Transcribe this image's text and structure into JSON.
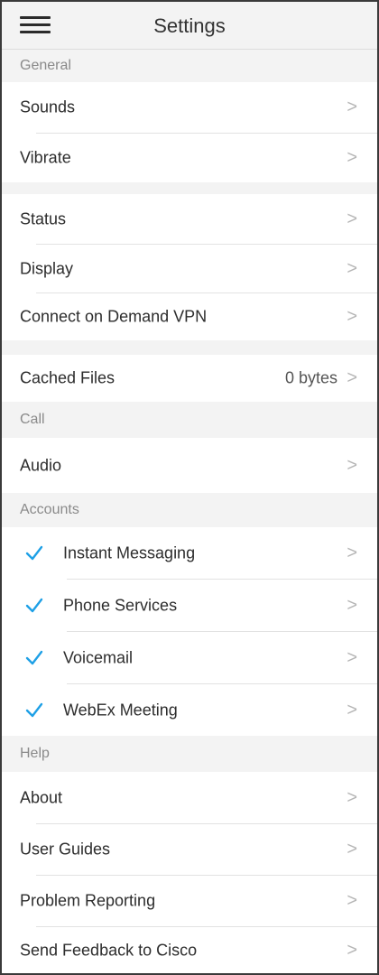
{
  "header": {
    "title": "Settings"
  },
  "colors": {
    "accent": "#1ea0e6"
  },
  "sections": {
    "general": "General",
    "call": "Call",
    "accounts": "Accounts",
    "help": "Help"
  },
  "items": {
    "sounds": "Sounds",
    "vibrate": "Vibrate",
    "status": "Status",
    "display": "Display",
    "vpn": "Connect on Demand VPN",
    "cached_files": "Cached Files",
    "cached_files_value": "0 bytes",
    "audio": "Audio",
    "instant_messaging": "Instant Messaging",
    "phone_services": "Phone Services",
    "voicemail": "Voicemail",
    "webex_meeting": "WebEx Meeting",
    "about": "About",
    "user_guides": "User Guides",
    "problem_reporting": "Problem Reporting",
    "send_feedback": "Send Feedback to Cisco"
  },
  "chevron_glyph": ">"
}
